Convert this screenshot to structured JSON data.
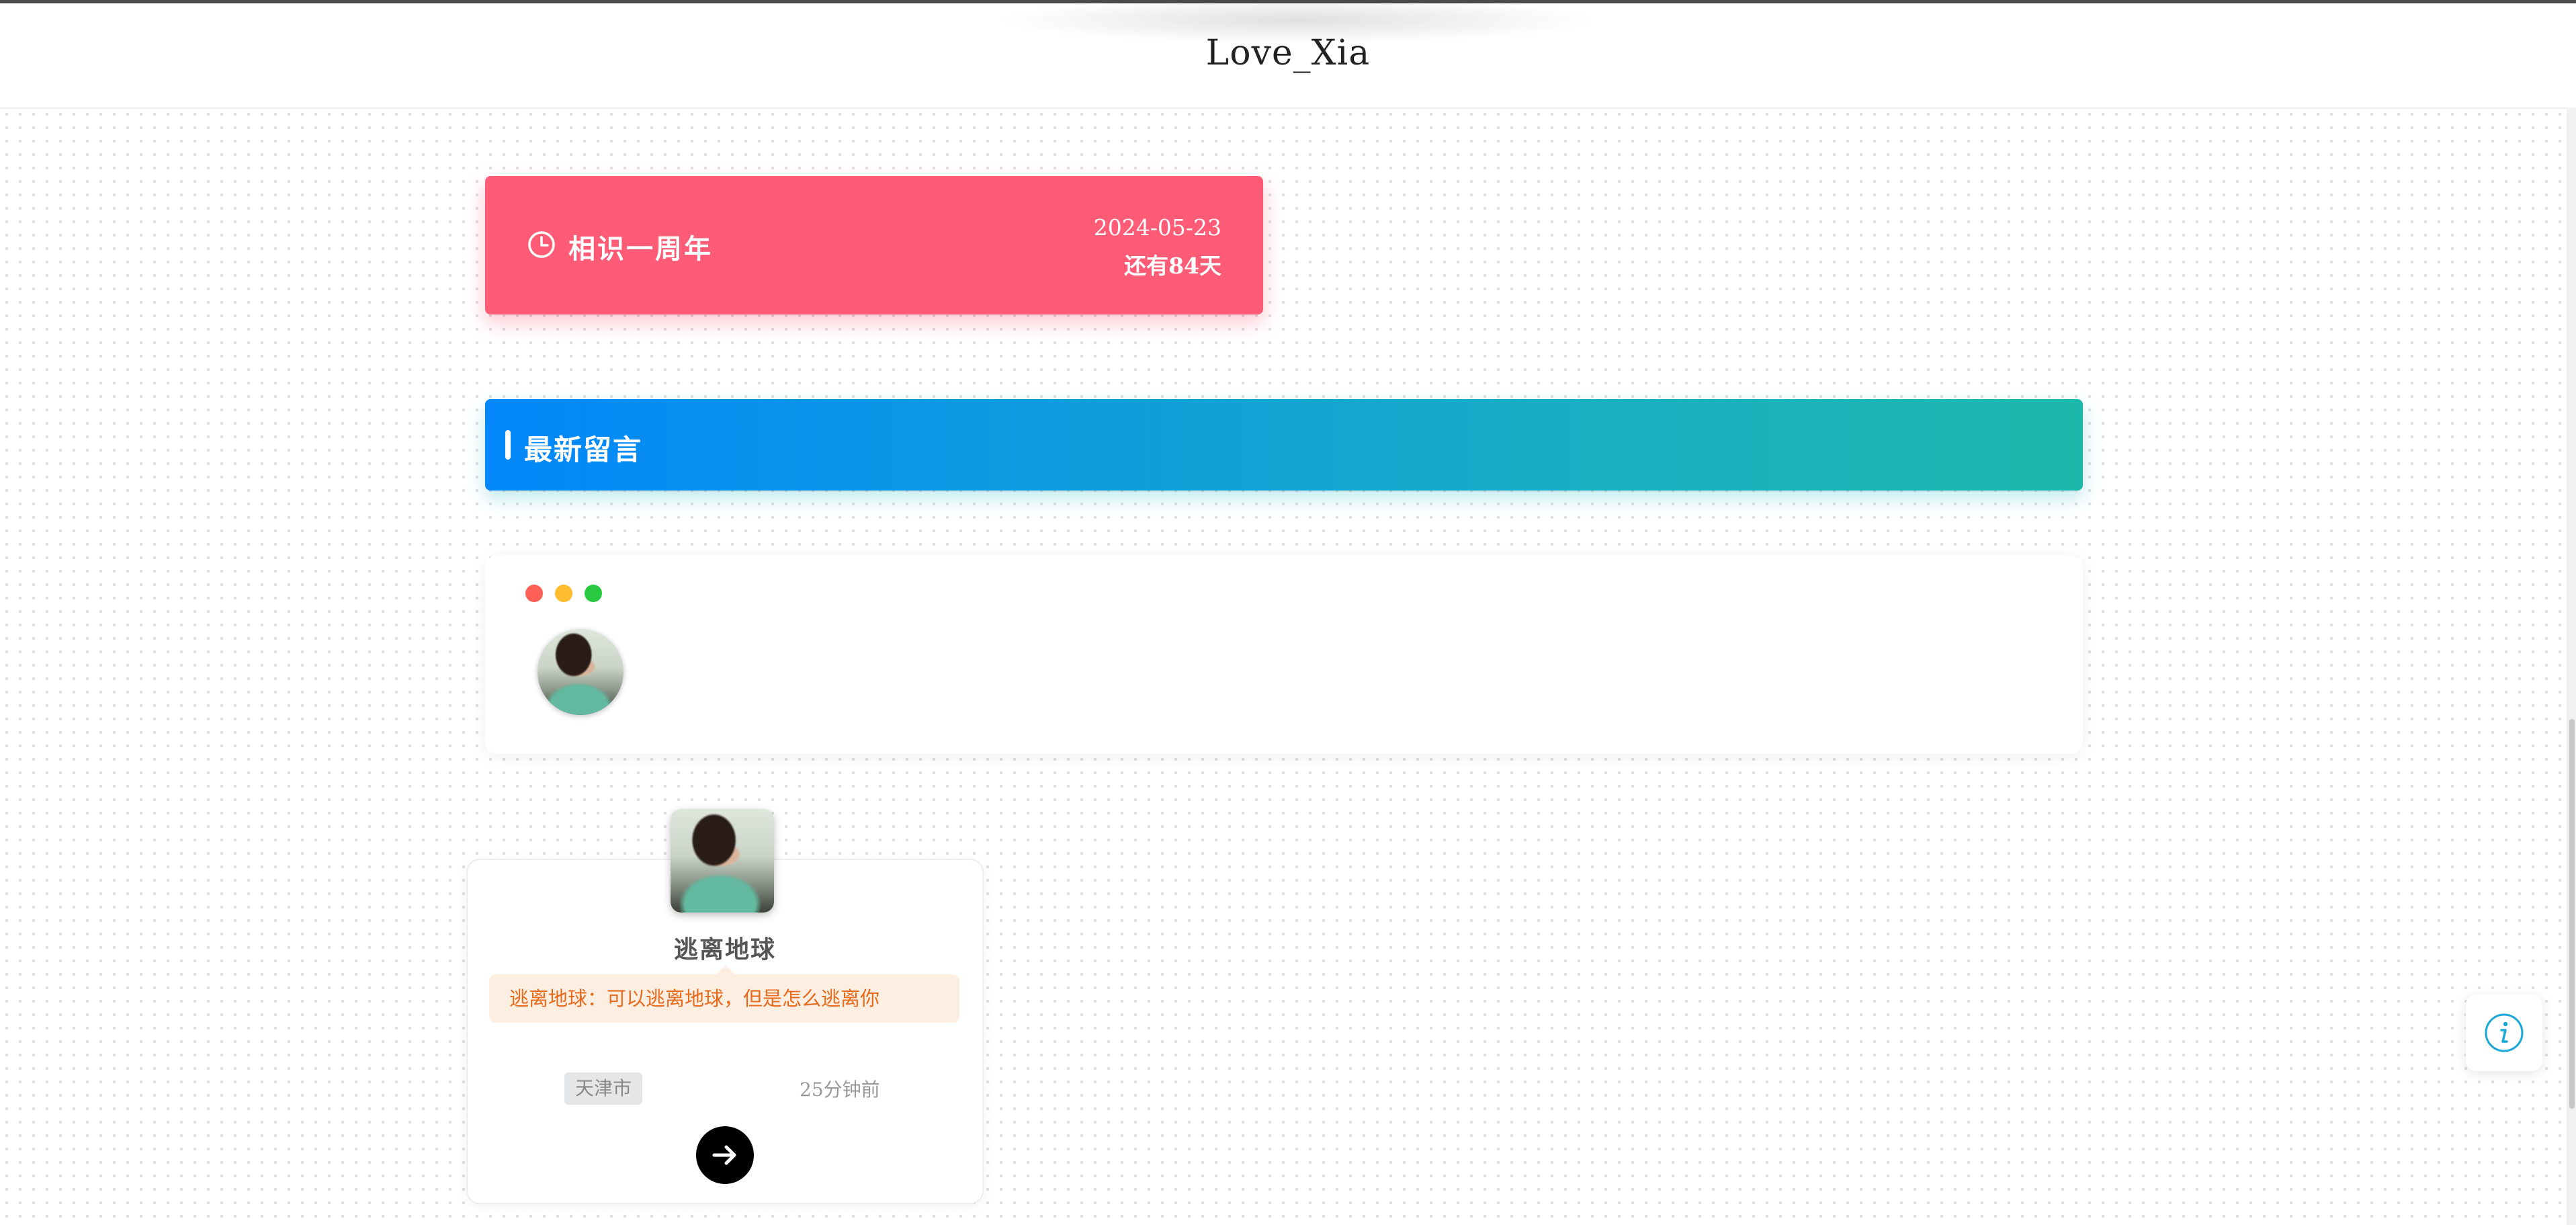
{
  "header": {
    "title": "Love_Xia"
  },
  "anniversary": {
    "title": "相识一周年",
    "date": "2024-05-23",
    "remaining": "还有84天",
    "color": "#fe5b77",
    "icon": "clock-icon"
  },
  "latest_messages": {
    "title": "最新留言"
  },
  "window_card": {
    "dots": [
      "#fe5f57",
      "#febc2e",
      "#28c840"
    ]
  },
  "message_card": {
    "name": "逃离地球",
    "content": "逃离地球：可以逃离地球，但是怎么逃离你",
    "location": "天津市",
    "time": "25分钟前",
    "go_icon": "arrow-right-icon"
  },
  "floating": {
    "info_icon": "info-icon",
    "accent": "#1aa7d8"
  }
}
